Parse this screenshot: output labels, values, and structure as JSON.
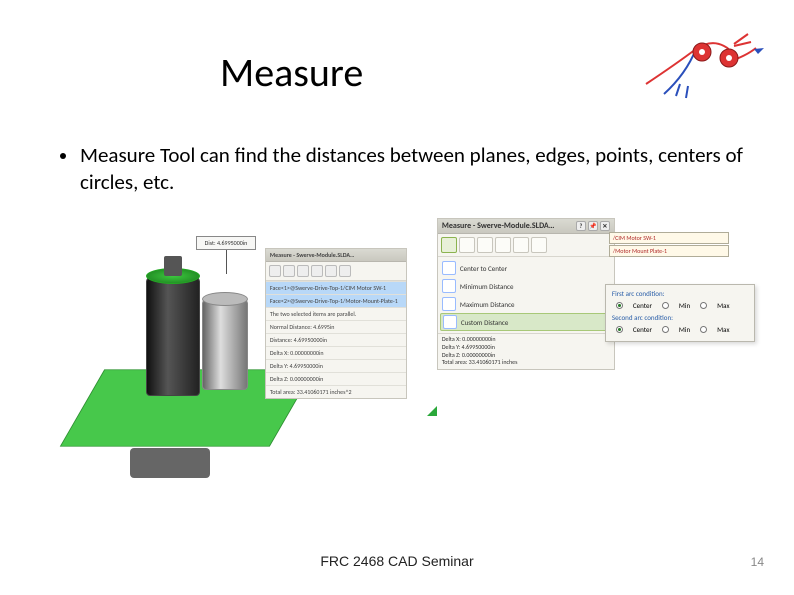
{
  "title": "Measure",
  "bullet": "Measure Tool can find the distances between planes, edges, points, centers of circles, etc.",
  "footer": "FRC 2468 CAD Seminar",
  "page": "14",
  "left_panel": {
    "title": "Measure - Swerve-Module.SLDA…",
    "callout": "Dist: 4.6995000in",
    "face1": "Face<1>@Swerve-Drive-Top-1/CIM Motor SW-1",
    "face2": "Face<2>@Swerve-Drive-Top-1/Motor-Mount-Plate-1",
    "note": "The two selected items are parallel.",
    "normal": "Normal Distance: 4.6995in",
    "dist": "Distance: 4.69950000in",
    "dx": "Delta X: 0.00000000in",
    "dy": "Delta Y: 4.69950000in",
    "dz": "Delta Z: 0.00000000in",
    "area": "Total area: 33.41060171 inches^2"
  },
  "right_panel": {
    "title": "Measure - Swerve-Module.SLDA…",
    "menu": {
      "c2c": "Center to Center",
      "min": "Minimum Distance",
      "max": "Maximum Distance",
      "custom": "Custom Distance"
    },
    "sel1": "/CIM Motor SW-1",
    "sel2": "/Motor Mount Plate-1",
    "dx": "Delta X: 0.00000000in",
    "dy": "Delta Y: 4.69950000in",
    "dz": "Delta Z: 0.00000000in",
    "area": "Total area: 33.41060171  inches"
  },
  "flyout": {
    "h1": "First arc condition:",
    "h2": "Second arc condition:",
    "opt_center": "Center",
    "opt_min": "Min",
    "opt_max": "Max"
  }
}
